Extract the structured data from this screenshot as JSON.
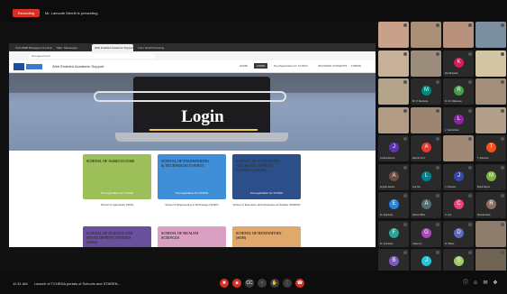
{
  "meet": {
    "recording_badge": "Recording",
    "title": "Mr. Lamonte Merritt is presenting",
    "clock": "11:31 AM",
    "presentation_caption": "Launch of TCHEDA portals of Schools and STAREN..."
  },
  "browser": {
    "tabs": [
      "UGA WEB Management portal",
      "Mail - Messenger",
      "Web Enabled Academic Support",
      "Form Grid Processing"
    ],
    "url": "hris.uga.edu.ph"
  },
  "site": {
    "title": "Web Enabled Academic Support",
    "nav": [
      "HOME",
      "LOGIN",
      "Pre-Registration for SY2023",
      "INCOMING STUDENTS",
      "FORMS"
    ],
    "nav_active": "LOGIN",
    "hero_title": "Login",
    "cards": [
      {
        "caption": "SCHOOL OF AGRICULTURE",
        "footer": "Pre-registration for SY2024",
        "label": "School of Agriculture (SOA)",
        "color": "#9dbf5a"
      },
      {
        "caption": "SCHOOL OF ENGINEERING & TECHNOLOGY (SOET)",
        "footer": "Pre-registration for SY2024",
        "label": "School of Engineering & Technology (SOET)",
        "color": "#3f8fd8"
      },
      {
        "caption": "SCHOOL OF EXTENSION AND DEVELOPMENT STUDIES (SOEDS)",
        "footer": "Pre-registration for SY2024",
        "label": "School of Extension and Development Studies (SOEDS)",
        "color": "#2c4f8a"
      },
      {
        "caption": "SCHOOL OF SCIENCE AND DEVELOPMENT STUDIES (SSDS)",
        "footer": "",
        "label": "",
        "color": "#6a4f9c"
      },
      {
        "caption": "SCHOOL OF HEALTH SCIENCES",
        "footer": "",
        "label": "",
        "color": "#d9a0c2"
      },
      {
        "caption": "SCHOOL OF HUMANITIES (SOH)",
        "footer": "",
        "label": "",
        "color": "#e0a86a"
      }
    ]
  },
  "participants": [
    {
      "name": "",
      "initial": "",
      "color": "#c9a18a",
      "video": true
    },
    {
      "name": "",
      "initial": "",
      "color": "#a88f76",
      "video": true
    },
    {
      "name": "",
      "initial": "",
      "color": "#b8927c",
      "video": true
    },
    {
      "name": "",
      "initial": "",
      "color": "#7b8fa1",
      "video": true
    },
    {
      "name": "",
      "initial": "",
      "color": "#c7b09a",
      "video": true
    },
    {
      "name": "",
      "initial": "",
      "color": "#9b8d7c",
      "video": true
    },
    {
      "name": "Kira Maxwell",
      "initial": "K",
      "color": "#d81b60",
      "video": false
    },
    {
      "name": "",
      "initial": "",
      "color": "#d3c4a3",
      "video": true
    },
    {
      "name": "",
      "initial": "",
      "color": "#b4a48a",
      "video": true
    },
    {
      "name": "Mr. P. Mendoza",
      "initial": "M",
      "color": "#00897b",
      "video": false
    },
    {
      "name": "Dr. R. Villanueva",
      "initial": "R",
      "color": "#43a047",
      "video": false
    },
    {
      "name": "",
      "initial": "",
      "color": "#a38e7a",
      "video": true
    },
    {
      "name": "",
      "initial": "",
      "color": "#b29b84",
      "video": true
    },
    {
      "name": "",
      "initial": "",
      "color": "#9c8672",
      "video": true
    },
    {
      "name": "L. Carmichael",
      "initial": "L",
      "color": "#8e24aa",
      "video": false
    },
    {
      "name": "",
      "initial": "",
      "color": "#b29f89",
      "video": true
    },
    {
      "name": "Justina Ramos",
      "initial": "J",
      "color": "#5e35b1",
      "video": false
    },
    {
      "name": "Alberto Cruz",
      "initial": "A",
      "color": "#e53935",
      "video": false
    },
    {
      "name": "",
      "initial": "",
      "color": "#a08a76",
      "video": true
    },
    {
      "name": "T. Abrenica",
      "initial": "T",
      "color": "#f4511e",
      "video": false
    },
    {
      "name": "Angelo Santos",
      "initial": "A",
      "color": "#6d4c41",
      "video": false
    },
    {
      "name": "Lea Tan",
      "initial": "L",
      "color": "#00838f",
      "video": false
    },
    {
      "name": "J. Ocampo",
      "initial": "J",
      "color": "#3949ab",
      "video": false
    },
    {
      "name": "Maria Reyes",
      "initial": "M",
      "color": "#7cb342",
      "video": false
    },
    {
      "name": "Dr. Espinosa",
      "initial": "E",
      "color": "#1e88e5",
      "video": false
    },
    {
      "name": "Admin Office",
      "initial": "A",
      "color": "#546e7a",
      "video": false
    },
    {
      "name": "C. Lim",
      "initial": "C",
      "color": "#ec407a",
      "video": false
    },
    {
      "name": "Ricardo Dela",
      "initial": "R",
      "color": "#8d6e63",
      "video": false
    },
    {
      "name": "Dr. Fernando",
      "initial": "F",
      "color": "#26a69a",
      "video": false
    },
    {
      "name": "Grace Uy",
      "initial": "G",
      "color": "#ab47bc",
      "video": false
    },
    {
      "name": "D. Hilario",
      "initial": "D",
      "color": "#5c6bc0",
      "video": false
    },
    {
      "name": "",
      "initial": "",
      "color": "#8f7d6b",
      "video": true
    },
    {
      "name": "B. Aquino",
      "initial": "B",
      "color": "#7e57c2",
      "video": false
    },
    {
      "name": "Joanna P.",
      "initial": "J",
      "color": "#26c6da",
      "video": false
    },
    {
      "name": "Dr. Sison",
      "initial": "S",
      "color": "#9ccc65",
      "video": false
    },
    {
      "name": "",
      "initial": "",
      "color": "#726454",
      "video": true
    }
  ],
  "controls": {
    "buttons": [
      "mic-off",
      "video-off",
      "captions",
      "present",
      "raise-hand",
      "more",
      "end-call"
    ],
    "right": [
      "info",
      "people",
      "chat",
      "activities"
    ]
  },
  "colors": {
    "accent_red": "#d93025",
    "meet_bg": "#0d0d0d",
    "underline": "#f2c94c"
  }
}
